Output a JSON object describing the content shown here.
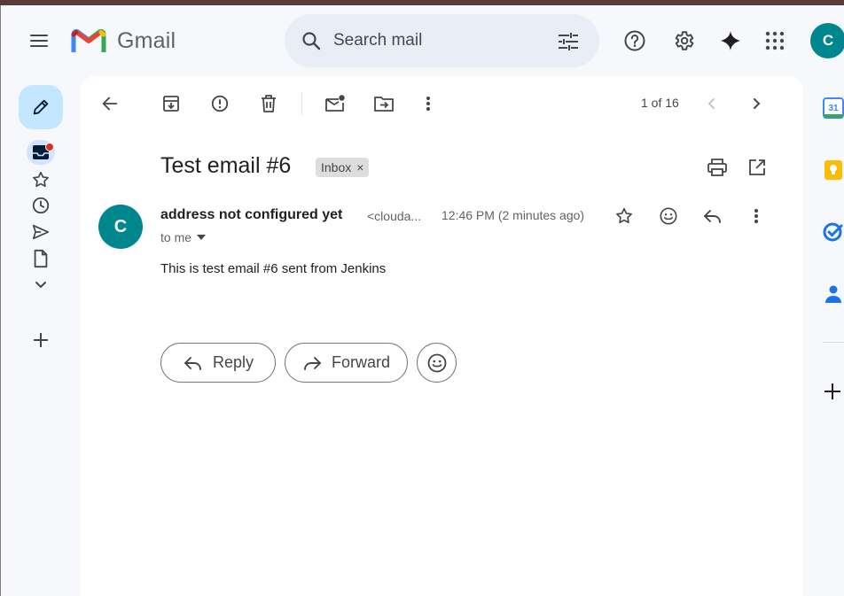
{
  "app": {
    "name": "Gmail",
    "avatar_letter": "C"
  },
  "search": {
    "placeholder": "Search mail"
  },
  "icons": {
    "hamburger": "menu-icon",
    "search": "search-icon",
    "tune": "tune-icon",
    "help": "help-icon",
    "settings": "gear-icon",
    "gemini": "sparkle-icon",
    "apps": "apps-grid-icon"
  },
  "nav": {
    "items": [
      "compose",
      "inbox",
      "starred",
      "snoozed",
      "sent",
      "drafts",
      "more",
      "new-label"
    ]
  },
  "toolbar": {
    "pager": "1 of 16"
  },
  "email": {
    "subject": "Test email #6",
    "label": "Inbox",
    "label_remove": "×",
    "sender_initial": "C",
    "sender_name": "address not configured yet",
    "sender_email": "<clouda...",
    "timestamp": "12:46 PM (2 minutes ago)",
    "recipient": "to me",
    "body": "This is test email #6 sent from Jenkins"
  },
  "actions": {
    "reply": "Reply",
    "forward": "Forward"
  },
  "side_panel": {
    "calendar_day": "31"
  },
  "colors": {
    "background": "#f6f8fc",
    "panel": "#ffffff",
    "compose": "#c2e7ff",
    "avatar": "#00868f",
    "search_bg": "#e9eef6",
    "gmail_red": "#ea4335",
    "gmail_blue": "#4285f4",
    "gmail_green": "#34a853",
    "gmail_yellow": "#fbbc04"
  }
}
